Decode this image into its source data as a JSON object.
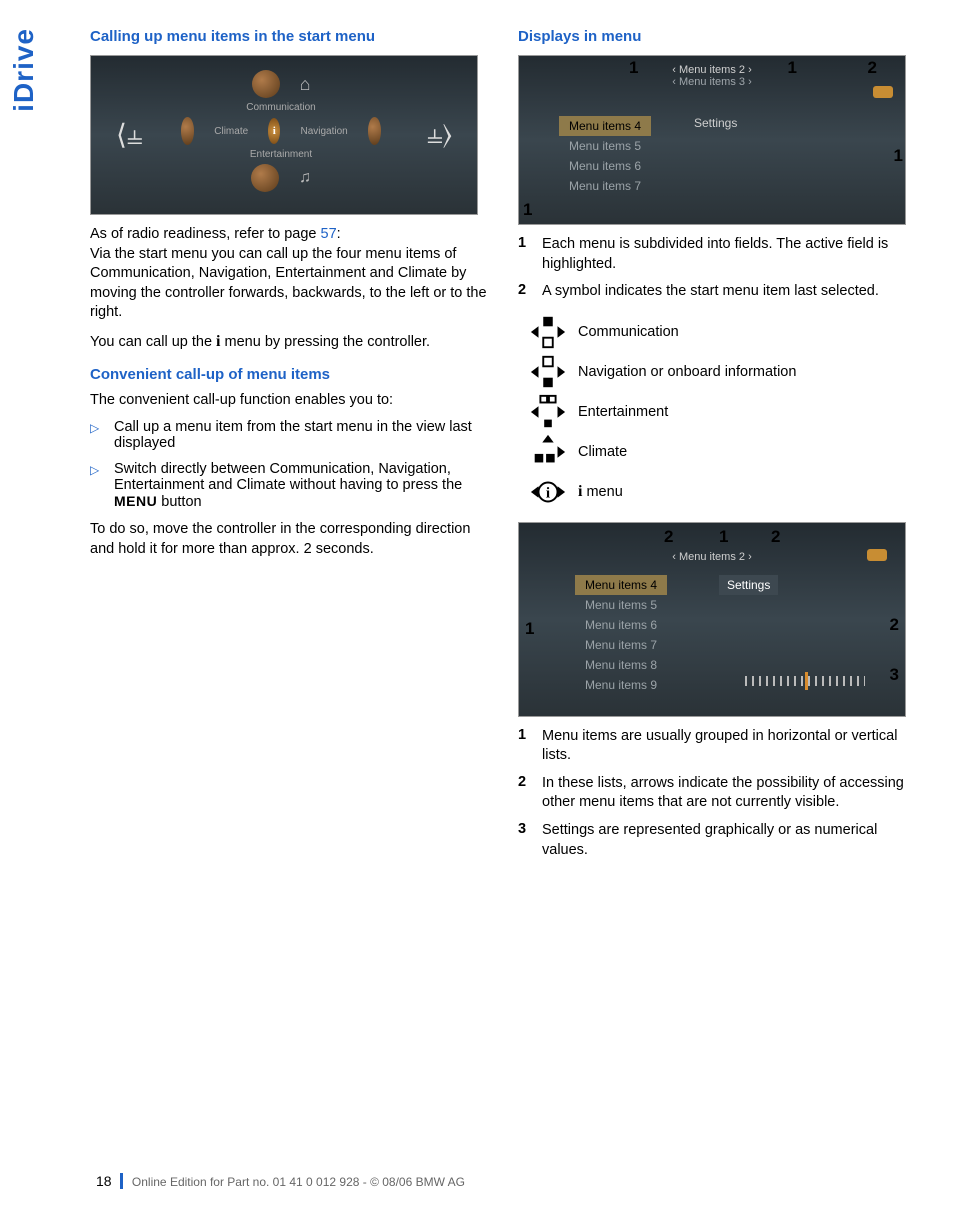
{
  "sideTab": "iDrive",
  "left": {
    "h_calling": "Calling up menu items in the start menu",
    "startmenu": {
      "top": "Communication",
      "left": "Climate",
      "right": "Navigation",
      "bottom": "Entertainment"
    },
    "p_radio_prefix": "As of radio readiness, refer to page ",
    "p_radio_page": "57",
    "p_radio_suffix": ":",
    "p_via": "Via the start menu you can call up the four menu items of Communication, Navigation, Entertainment and Climate by moving the controller forwards, backwards, to the left or to the right.",
    "p_callup_a": "You can call up the ",
    "p_callup_b": " menu by pressing the controller.",
    "h_convenient": "Convenient call-up of menu items",
    "p_convenient_intro": "The convenient call-up function enables you to:",
    "bul1": "Call up a menu item from the start menu in the view last displayed",
    "bul2_a": "Switch directly between Communication, Navigation, Entertainment and Climate without having to press the ",
    "bul2_b": " button",
    "p_todo": "To do so, move the controller in the corresponding direction and hold it for more than approx. 2 seconds."
  },
  "right": {
    "h_displays": "Displays in menu",
    "menu2": {
      "t1": "‹ Menu items 2 ›",
      "t2": "‹ Menu items 3 ›",
      "l1": "Menu items 4",
      "l2": "Menu items 5",
      "l3": "Menu items 6",
      "l4": "Menu items 7",
      "settings": "Settings"
    },
    "list1": {
      "n1": "1",
      "t1": "Each menu is subdivided into fields. The active field is highlighted.",
      "n2": "2",
      "t2": "A symbol indicates the start menu item last selected."
    },
    "icons": {
      "comm": "Communication",
      "nav": "Navigation or onboard information",
      "ent": "Entertainment",
      "clim": "Climate",
      "imenu": " menu"
    },
    "menu3": {
      "top": "‹ Menu items 2 ›",
      "l1": "Menu items 4",
      "l2": "Menu items 5",
      "l3": "Menu items 6",
      "l4": "Menu items 7",
      "l5": "Menu items 8",
      "l6": "Menu items 9",
      "settings": "Settings"
    },
    "list2": {
      "n1": "1",
      "t1": "Menu items are usually grouped in horizontal or vertical lists.",
      "n2": "2",
      "t2": "In these lists, arrows indicate the possibility of accessing other menu items that are not currently visible.",
      "n3": "3",
      "t3": "Settings are represented graphically or as numerical values."
    }
  },
  "footer": {
    "page": "18",
    "text": "Online Edition for Part no. 01 41 0 012 928 - © 08/06 BMW AG"
  },
  "glyphs": {
    "i": "i",
    "menu": "MENU",
    "tri": "▷"
  }
}
